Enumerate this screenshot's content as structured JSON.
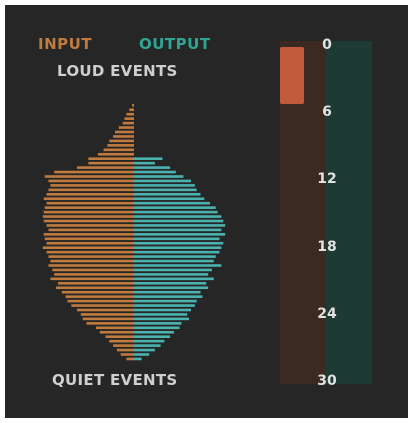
{
  "legend": {
    "input_label": "INPUT",
    "output_label": "OUTPUT",
    "input_color": "#c17b3f",
    "output_color": "#4ab3b0"
  },
  "axis": {
    "loud_label": "LOUD EVENTS",
    "quiet_label": "QUIET EVENTS"
  },
  "meter": {
    "ticks": [
      "0",
      "6",
      "12",
      "18",
      "24",
      "30"
    ],
    "min": 0,
    "max": 30,
    "input_level": 2.5,
    "input_fill_color": "#c45a3c",
    "input_track_color": "#3b2a22",
    "output_track_color": "#1e3b33"
  },
  "histogram": {
    "input_lengths": [
      2,
      5,
      8,
      10,
      12,
      16,
      20,
      22,
      26,
      28,
      32,
      38,
      48,
      48,
      60,
      84,
      94,
      90,
      88,
      90,
      92,
      95,
      92,
      94,
      95,
      96,
      95,
      92,
      90,
      95,
      94,
      92,
      96,
      92,
      90,
      88,
      90,
      86,
      84,
      88,
      80,
      82,
      76,
      72,
      70,
      66,
      60,
      56,
      54,
      50,
      40,
      36,
      30,
      26,
      22,
      18,
      14,
      8
    ],
    "output_lengths": [
      0,
      0,
      0,
      0,
      0,
      0,
      0,
      0,
      0,
      0,
      0,
      0,
      30,
      22,
      38,
      44,
      52,
      60,
      64,
      66,
      70,
      74,
      80,
      86,
      88,
      92,
      94,
      96,
      92,
      96,
      90,
      94,
      92,
      90,
      86,
      84,
      92,
      82,
      78,
      84,
      76,
      78,
      70,
      72,
      66,
      64,
      60,
      56,
      58,
      50,
      48,
      42,
      38,
      32,
      28,
      22,
      16,
      8
    ]
  }
}
